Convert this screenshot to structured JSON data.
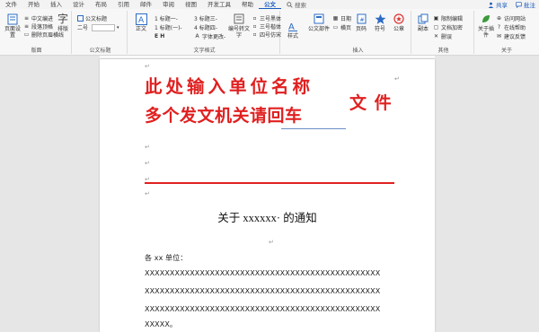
{
  "menu": {
    "tabs": [
      "文件",
      "开始",
      "插入",
      "设计",
      "布局",
      "引用",
      "邮件",
      "审阅",
      "视图",
      "开发工具",
      "帮助",
      "公文"
    ],
    "active_tab": "公文",
    "search_label": "搜索",
    "share_label": "共享",
    "comment_label": "批注"
  },
  "ribbon": {
    "group_layout": {
      "label": "版面",
      "page_setup": "页面设置",
      "items": [
        "中文编进",
        "段落顶格",
        "删除页眉横线"
      ],
      "typeset": "排版"
    },
    "group_official": {
      "label": "公文标题",
      "title_item": "公文标题",
      "level2": "二号"
    },
    "group_text": {
      "label": "文字格式",
      "body": "正文",
      "items": [
        "1 标题一-",
        "3 标题三-",
        "1 标题(一)-",
        "4 标题四-",
        "E H",
        "字体更改-"
      ],
      "numbering": "编号转文字",
      "styles": [
        "三号黑体",
        "三号楷体",
        "四号仿宋"
      ],
      "style_label": "样式"
    },
    "group_insert": {
      "label": "插入",
      "doc_parts": "公文部件",
      "items": [
        "日期",
        "横页"
      ],
      "page_num": "页码",
      "symbol": "符号",
      "seal": "公章"
    },
    "group_other": {
      "label": "其他",
      "copy": "副本",
      "items": [
        "限制编辑",
        "文档加密",
        "删误"
      ]
    },
    "group_about": {
      "label": "关于",
      "about": "关于插件",
      "items": [
        "访问网站",
        "在线帮助",
        "建议反馈"
      ]
    }
  },
  "document": {
    "org_name_line1": "此处输入单位名称",
    "org_name_line2": "多个发文机关请回车",
    "file_word": "文 件",
    "title": "关于 xxxxxx· 的通知",
    "salutation": "各 xx 单位：",
    "body_lines": [
      "XXXXXXXXXXXXXXXXXXXXXXXXXXXXXXXXXXXXXXXXXXXXXXX",
      "XXXXXXXXXXXXXXXXXXXXXXXXXXXXXXXXXXXXXXXXXXXXXXX",
      "XXXXXXXXXXXXXXXXXXXXXXXXXXXXXXXXXXXXXXXXXXXXXXX",
      "XXXXX。"
    ]
  },
  "colors": {
    "red_heading": "#e02020",
    "accent": "#185abd"
  }
}
